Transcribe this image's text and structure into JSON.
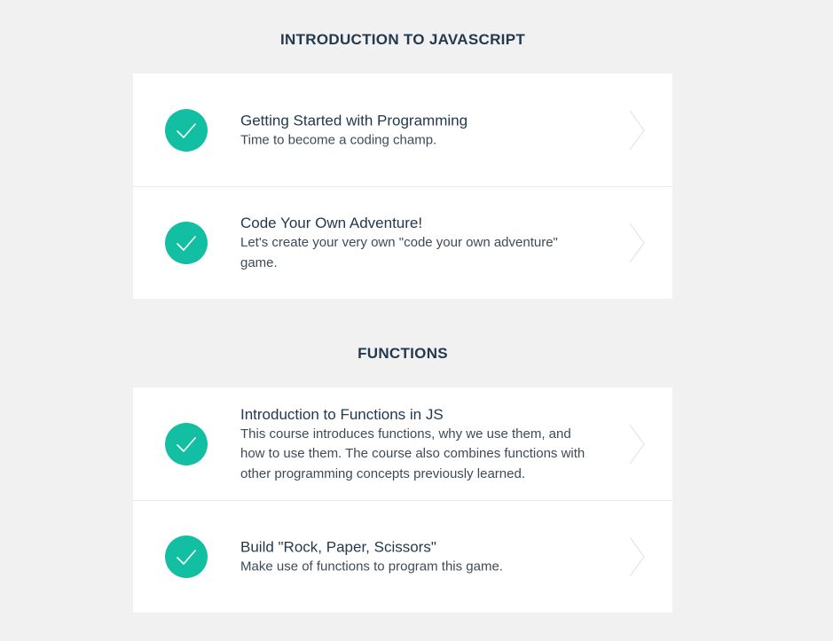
{
  "sections": [
    {
      "title": "INTRODUCTION TO JAVASCRIPT",
      "courses": [
        {
          "title": "Getting Started with Programming",
          "description": "Time to become a coding champ.",
          "status_icon": "check-circle-icon",
          "arrow_icon": "chevron-right-icon"
        },
        {
          "title": "Code Your Own Adventure!",
          "description": "Let's create your very own \"code your own adventure\" game.",
          "status_icon": "check-circle-icon",
          "arrow_icon": "chevron-right-icon"
        }
      ]
    },
    {
      "title": "FUNCTIONS",
      "courses": [
        {
          "title": "Introduction to Functions in JS",
          "description": "This course introduces functions, why we use them, and how to use them. The course also combines functions with other programming concepts previously learned.",
          "status_icon": "check-circle-icon",
          "arrow_icon": "chevron-right-icon"
        },
        {
          "title": "Build \"Rock, Paper, Scissors\"",
          "description": "Make use of functions to program this game.",
          "status_icon": "check-circle-icon",
          "arrow_icon": "chevron-right-icon"
        }
      ]
    }
  ],
  "colors": {
    "page_background": "#f0f1f0",
    "card_background": "#ffffff",
    "check_circle": "#12bfa2",
    "heading_text": "#23394d",
    "body_text": "#3d4b57",
    "chevron": "#e4e7e8"
  }
}
